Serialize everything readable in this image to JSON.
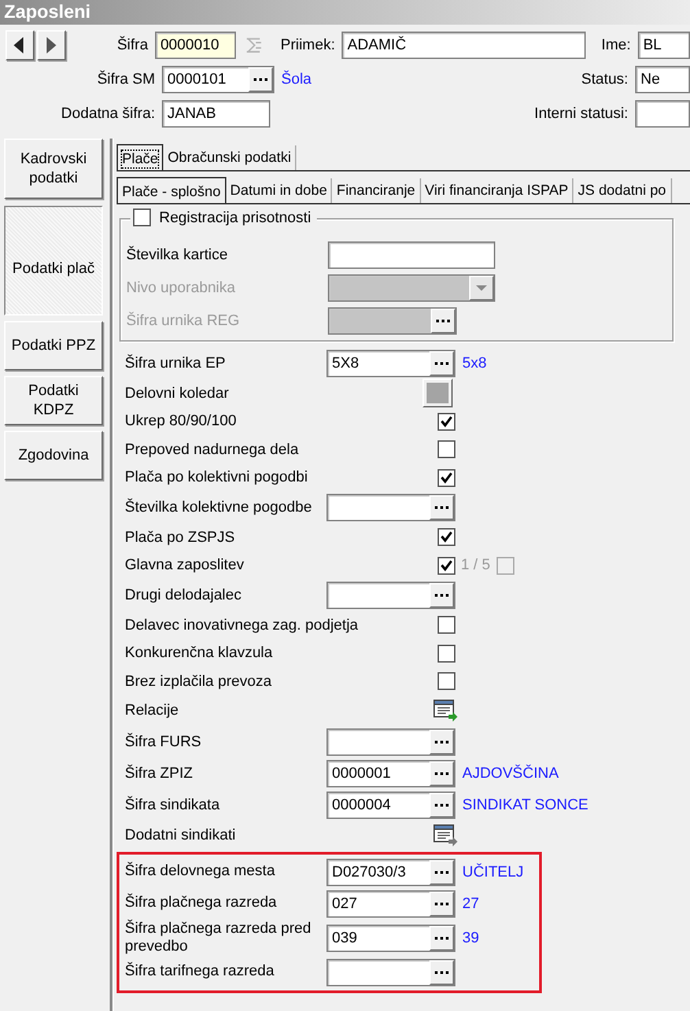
{
  "window": {
    "title": "Zaposleni"
  },
  "header": {
    "sifra": {
      "label": "Šifra",
      "value": "0000010"
    },
    "priimek": {
      "label": "Priimek:",
      "value": "ADAMIČ"
    },
    "ime": {
      "label": "Ime:",
      "value": "BL"
    },
    "sifra_sm": {
      "label": "Šifra SM",
      "value": "0000101",
      "description": "Šola"
    },
    "status": {
      "label": "Status:",
      "value": "Ne"
    },
    "dodatna_sifra": {
      "label": "Dodatna šifra:",
      "value": "JANAB"
    },
    "interni_statusi": {
      "label": "Interni statusi:"
    }
  },
  "sidebar": {
    "items": [
      {
        "label": "Kadrovski podatki",
        "selected": false
      },
      {
        "label": "Podatki plač",
        "selected": true
      },
      {
        "label": "Podatki PPZ",
        "selected": false
      },
      {
        "label": "Podatki KDPZ",
        "selected": false
      },
      {
        "label": "Zgodovina",
        "selected": false
      }
    ]
  },
  "tabs": [
    {
      "label": "Plače",
      "selected": true
    },
    {
      "label": "Obračunski podatki",
      "selected": false
    }
  ],
  "subtabs": [
    {
      "label": "Plače - splošno",
      "selected": true
    },
    {
      "label": "Datumi in dobe",
      "selected": false
    },
    {
      "label": "Financiranje",
      "selected": false
    },
    {
      "label": "Viri financiranja ISPAP",
      "selected": false
    },
    {
      "label": "JS dodatni po",
      "selected": false
    }
  ],
  "group": {
    "label": "Registracija prisotnosti",
    "checked": false,
    "rows": [
      {
        "kind": "text",
        "label": "Številka kartice",
        "disabled": false
      },
      {
        "kind": "combo",
        "label": "Nivo uporabnika",
        "disabled": true
      },
      {
        "kind": "lookup",
        "label": "Šifra urnika REG",
        "disabled": true
      }
    ]
  },
  "rows": [
    {
      "kind": "lookup",
      "label": "Šifra urnika EP",
      "value": "5X8",
      "description": "5x8"
    },
    {
      "kind": "button",
      "label": "Delovni koledar"
    },
    {
      "kind": "check",
      "label": "Ukrep 80/90/100",
      "checked": true
    },
    {
      "kind": "check",
      "label": "Prepoved nadurnega dela",
      "checked": false
    },
    {
      "kind": "check",
      "label": "Plača po kolektivni pogodbi",
      "checked": true
    },
    {
      "kind": "lookup",
      "label": "Številka kolektivne pogodbe"
    },
    {
      "kind": "check",
      "label": "Plača po ZSPJS",
      "checked": true
    },
    {
      "kind": "check",
      "label": "Glavna zaposlitev",
      "checked": true,
      "counter": "1 / 5",
      "extra_checked": false
    },
    {
      "kind": "lookup",
      "label": "Drugi delodajalec"
    },
    {
      "kind": "check",
      "label": "Delavec inovativnega zag. podjetja",
      "checked": false
    },
    {
      "kind": "check",
      "label": "Konkurenčna klavzula",
      "checked": false
    },
    {
      "kind": "check",
      "label": "Brez izplačila prevoza",
      "checked": false
    },
    {
      "kind": "icon",
      "label": "Relacije",
      "active": true
    },
    {
      "kind": "lookup",
      "label": "Šifra FURS"
    },
    {
      "kind": "lookup",
      "label": "Šifra ZPIZ",
      "value": "0000001",
      "description": "AJDOVŠČINA"
    },
    {
      "kind": "lookup",
      "label": "Šifra sindikata",
      "value": "0000004",
      "description": "SINDIKAT SONCE"
    },
    {
      "kind": "icon",
      "label": "Dodatni sindikati",
      "active": false
    }
  ],
  "highlighted_rows": [
    {
      "kind": "lookup",
      "label": "Šifra delovnega mesta",
      "value": "D027030/3",
      "description": "UČITELJ"
    },
    {
      "kind": "lookup",
      "label": "Šifra plačnega razreda",
      "value": "027",
      "description": "27"
    },
    {
      "kind": "lookup",
      "label": "Šifra plačnega razreda pred prevedbo",
      "value": "039",
      "description": "39"
    },
    {
      "kind": "lookup",
      "label": "Šifra tarifnega razreda"
    }
  ]
}
